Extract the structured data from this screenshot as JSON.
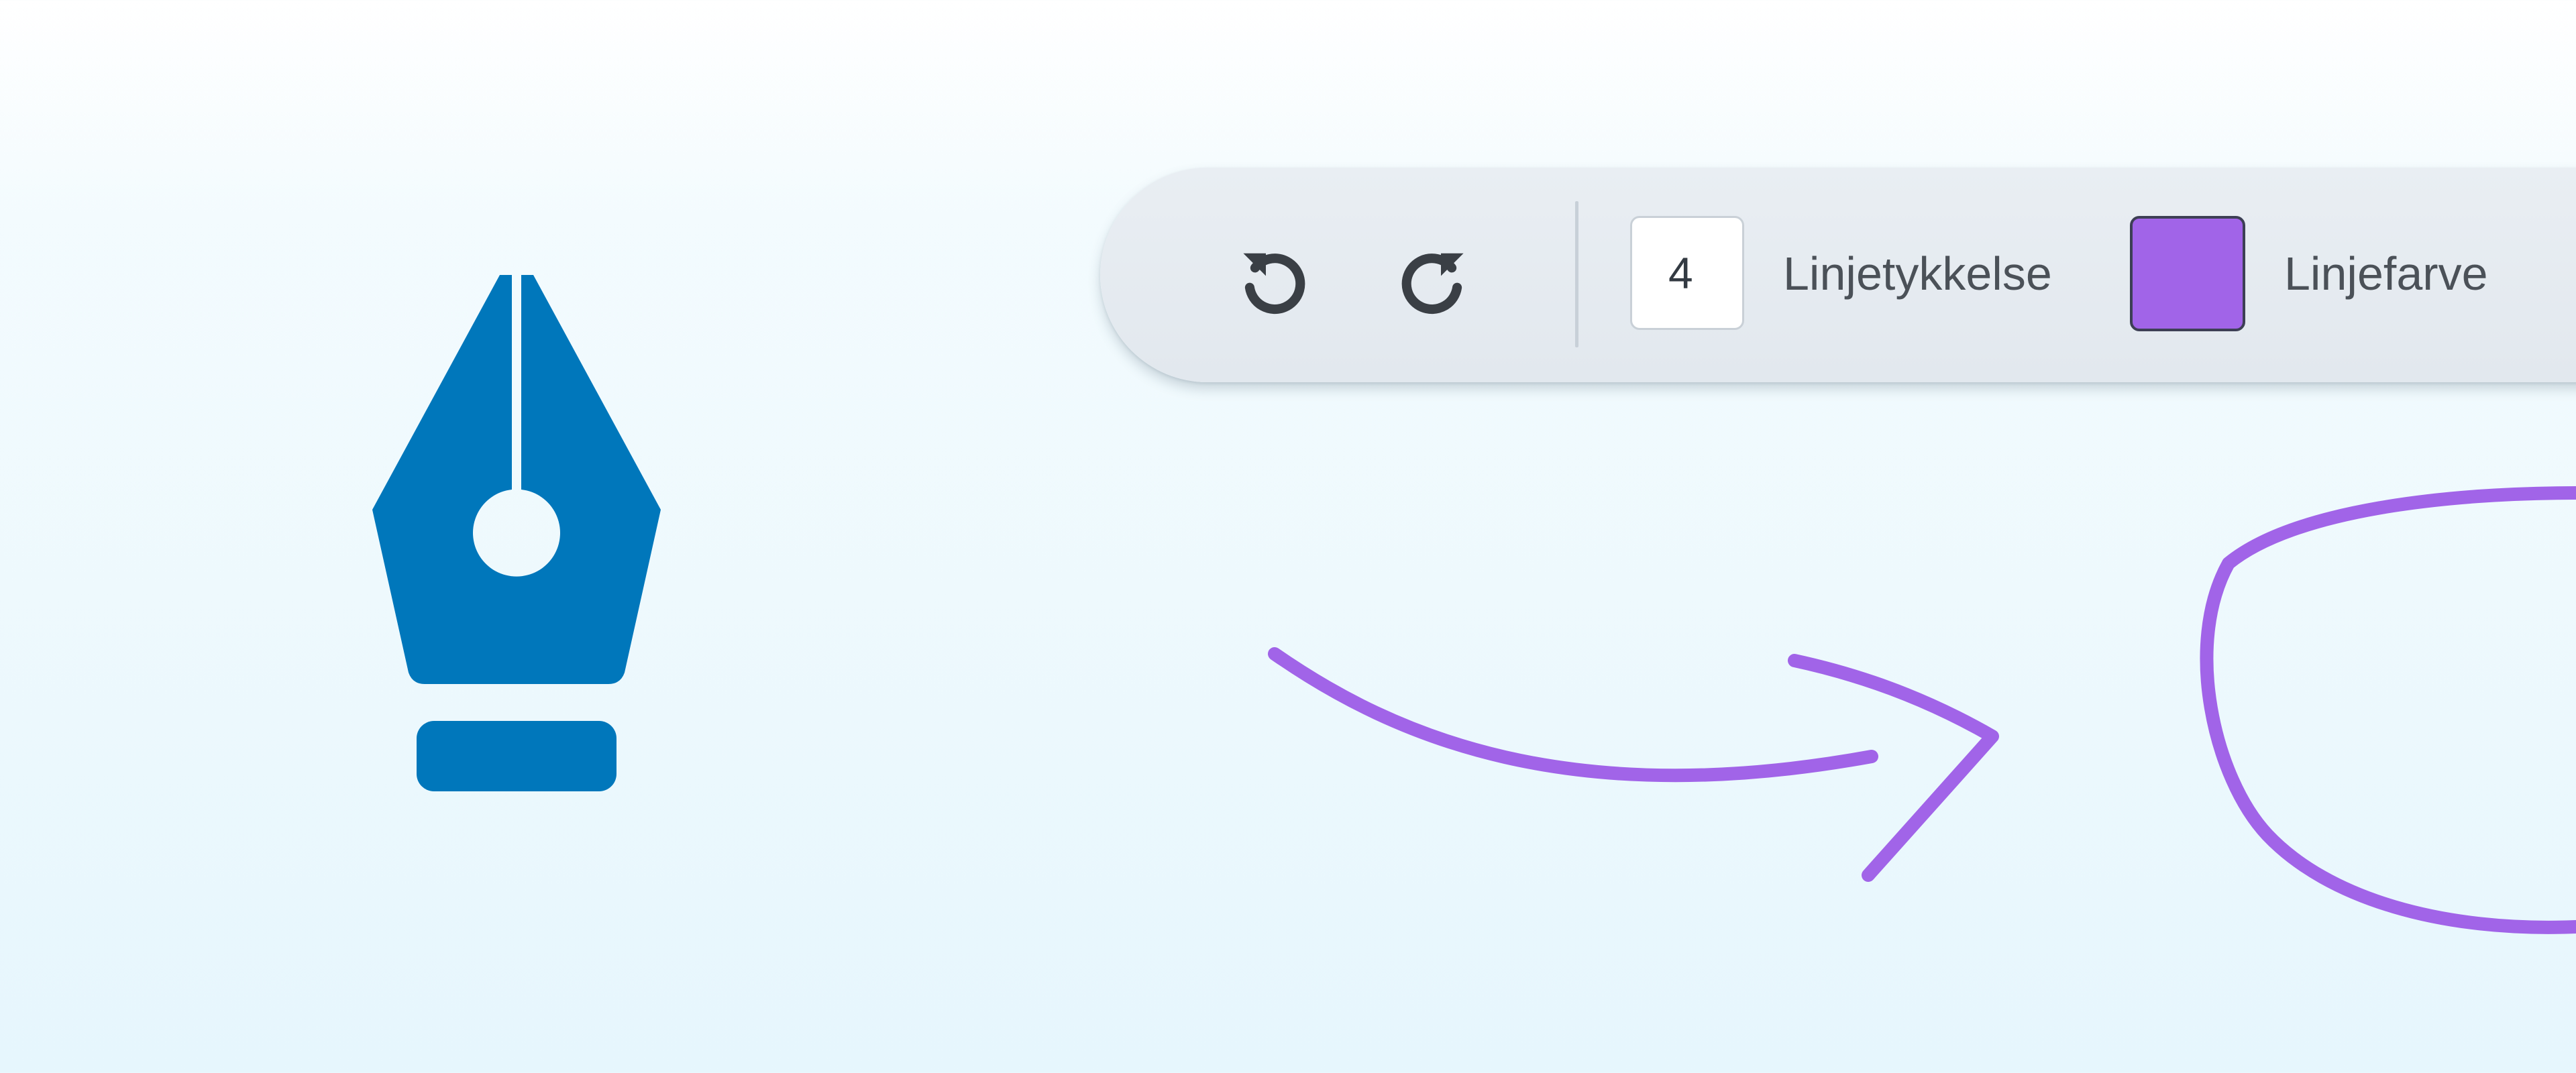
{
  "colors": {
    "brand": "#0077bb",
    "line_color": "#a164e8",
    "icon": "#3a3f45"
  },
  "logo": {
    "icon": "fountain-pen-nib-icon"
  },
  "toolbar": {
    "undo_icon": "undo-icon",
    "redo_icon": "redo-icon",
    "line_width": {
      "value": "4",
      "label": "Linjetykkelse"
    },
    "line_color": {
      "value": "#a164e8",
      "label": "Linjefarve"
    }
  },
  "canvas": {
    "strokes": [
      "curved-arrow",
      "loop"
    ]
  }
}
